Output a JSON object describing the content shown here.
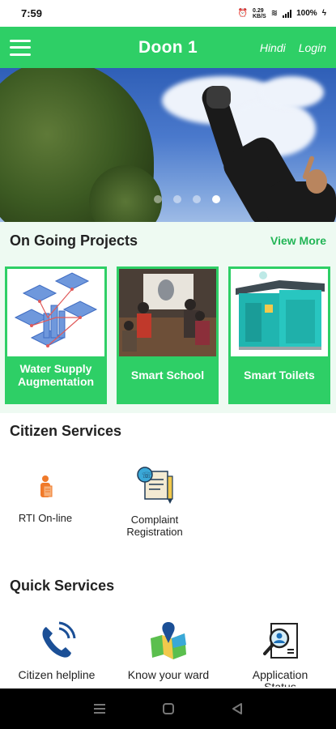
{
  "status": {
    "time": "7:59",
    "battery": "100%",
    "net_speed": "0.29\nKB/S"
  },
  "header": {
    "title": "Doon 1",
    "hindi_label": "Hindi",
    "login_label": "Login"
  },
  "banner": {
    "slide_count": 4,
    "active_slide": 4
  },
  "projects": {
    "title": "On Going Projects",
    "view_more": "View More",
    "items": [
      {
        "label": "Water Supply Augmentation"
      },
      {
        "label": "Smart School"
      },
      {
        "label": "Smart Toilets"
      }
    ]
  },
  "citizen_services": {
    "title": "Citizen Services",
    "items": [
      {
        "label": "RTI On-line",
        "icon": "rti-document-icon"
      },
      {
        "label": "Complaint Registration",
        "icon": "complaint-registration-icon"
      }
    ]
  },
  "quick_services": {
    "title": "Quick Services",
    "items": [
      {
        "label": "Citizen helpline",
        "icon": "phone-icon"
      },
      {
        "label": "Know your ward name",
        "icon": "map-pin-icon"
      },
      {
        "label": "Application Status",
        "icon": "application-search-icon"
      }
    ]
  },
  "colors": {
    "accent": "#2ecf66",
    "section_bg": "#eefaf2",
    "link": "#22b556"
  }
}
